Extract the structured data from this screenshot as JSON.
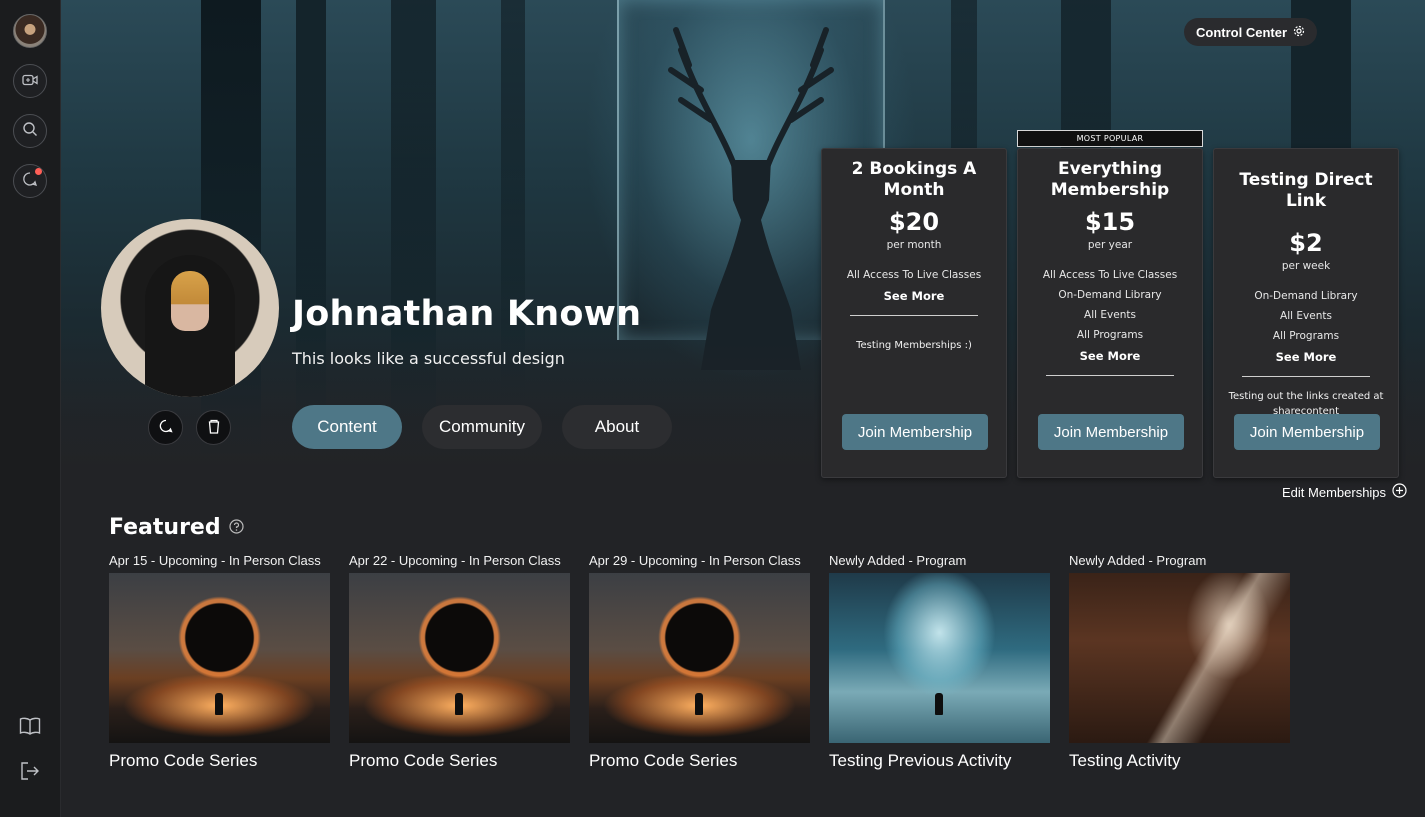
{
  "header": {
    "control_center_label": "Control Center"
  },
  "sidebar": {
    "items": [
      {
        "name": "avatar"
      },
      {
        "name": "video-icon"
      },
      {
        "name": "search-icon"
      },
      {
        "name": "chat-icon"
      }
    ],
    "bottom_items": [
      {
        "name": "book-icon"
      },
      {
        "name": "logout-icon"
      }
    ]
  },
  "profile": {
    "name": "Johnathan Known",
    "tagline": "This looks like a successful design"
  },
  "tabs": [
    {
      "label": "Content",
      "active": true
    },
    {
      "label": "Community",
      "active": false
    },
    {
      "label": "About",
      "active": false
    }
  ],
  "memberships": {
    "most_popular_label": "MOST POPULAR",
    "edit_label": "Edit Memberships",
    "cards": [
      {
        "title": "2 Bookings A Month",
        "price": "$20",
        "period": "per month",
        "features": [
          "All Access To Live Classes"
        ],
        "see_more": "See More",
        "description": "Testing Memberships :)",
        "join_label": "Join Membership"
      },
      {
        "title": "Everything Membership",
        "price": "$15",
        "period": "per year",
        "features": [
          "All Access To Live Classes",
          "On-Demand Library",
          "All Events",
          "All Programs"
        ],
        "see_more": "See More",
        "description": "",
        "join_label": "Join Membership"
      },
      {
        "title": "Testing Direct Link",
        "price": "$2",
        "period": "per week",
        "features": [
          "On-Demand Library",
          "All Events",
          "All Programs"
        ],
        "see_more": "See More",
        "description": "Testing out the links created at sharecontent",
        "join_label": "Join Membership"
      }
    ]
  },
  "featured": {
    "title": "Featured",
    "items": [
      {
        "meta": "Apr 15 - Upcoming - In Person Class",
        "caption": "Promo Code Series",
        "image": "eclipse"
      },
      {
        "meta": "Apr 22 - Upcoming - In Person Class",
        "caption": "Promo Code Series",
        "image": "eclipse"
      },
      {
        "meta": "Apr 29 - Upcoming - In Person Class",
        "caption": "Promo Code Series",
        "image": "eclipse"
      },
      {
        "meta": "Newly Added - Program",
        "caption": "Testing Previous Activity",
        "image": "crystal"
      },
      {
        "meta": "Newly Added - Program",
        "caption": "Testing Activity",
        "image": "cathedral"
      }
    ]
  },
  "colors": {
    "accent": "#4e7787",
    "background": "#222326",
    "sidebar": "#1b1c1e",
    "card": "#2a2a2c",
    "notification": "#ff5f57"
  }
}
